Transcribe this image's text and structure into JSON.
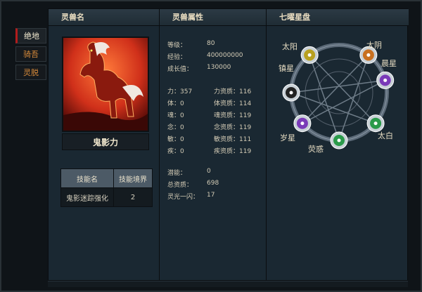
{
  "headers": {
    "beast_name": "灵兽名",
    "attributes": "灵兽属性",
    "star_chart": "七曜星盘"
  },
  "side_tabs": [
    {
      "label": "绝地",
      "active": true
    },
    {
      "label": "骑吾",
      "active": false
    },
    {
      "label": "灵脱",
      "active": false
    }
  ],
  "beast": {
    "name": "鬼影力"
  },
  "skills": {
    "headers": [
      "技能名",
      "技能境界"
    ],
    "rows": [
      {
        "name": "鬼影迷踪强化",
        "level": "2"
      }
    ]
  },
  "basic": [
    {
      "label": "等级：",
      "value": "80"
    },
    {
      "label": "经验：",
      "value": "400000000"
    },
    {
      "label": "成长值：",
      "value": "130000"
    }
  ],
  "attrs": [
    {
      "stat": "力：357",
      "apt": "力资质：116"
    },
    {
      "stat": "体：0",
      "apt": "体资质：114"
    },
    {
      "stat": "魂：0",
      "apt": "魂资质：119"
    },
    {
      "stat": "念：0",
      "apt": "念资质：119"
    },
    {
      "stat": "敏：0",
      "apt": "敏资质：111"
    },
    {
      "stat": "疾：0",
      "apt": "疾资质：119"
    }
  ],
  "extra": [
    {
      "label": "潜能：",
      "value": "0"
    },
    {
      "label": "总资质：",
      "value": "698"
    },
    {
      "label": "灵光一闪：",
      "value": "17"
    }
  ],
  "stars": [
    {
      "label": "太阳",
      "color": "#b8a020"
    },
    {
      "label": "太阴",
      "color": "#c87020"
    },
    {
      "label": "晨星",
      "color": "#7a3ab8"
    },
    {
      "label": "太白",
      "color": "#2a9a4a"
    },
    {
      "label": "荧惑",
      "color": "#2a9a4a"
    },
    {
      "label": "岁星",
      "color": "#7a3ab8"
    },
    {
      "label": "镇星",
      "color": "#222222"
    }
  ]
}
